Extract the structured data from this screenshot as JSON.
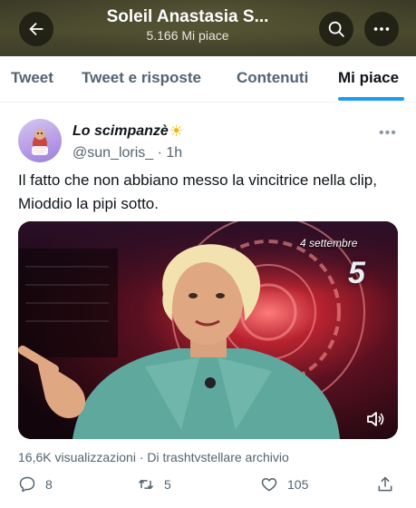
{
  "header": {
    "title": "Soleil Anastasia S...",
    "subtitle": "5.166 Mi piace",
    "back_icon": "arrow-left-icon",
    "search_icon": "search-icon",
    "more_icon": "more-horizontal-icon"
  },
  "tabs": [
    {
      "label": "Tweet",
      "active": false
    },
    {
      "label": "Tweet e risposte",
      "active": false
    },
    {
      "label": "Contenuti",
      "active": false
    },
    {
      "label": "Mi piace",
      "active": true
    }
  ],
  "tweet": {
    "author_name": "Lo scimpanzè",
    "author_emoji": "☀",
    "handle": "@sun_loris_",
    "time": "· 1h",
    "text": "Il fatto che non abbiano messo la vincitrice nella clip, Mioddio la pipi sotto.",
    "media": {
      "overlay_date": "4 settembre",
      "channel_logo": "5"
    },
    "meta": "16,6K visualizzazioni · Di trashtvstellare archivio",
    "actions": {
      "replies": "8",
      "retweets": "5",
      "likes": "105"
    }
  },
  "colors": {
    "accent": "#1d9bf0",
    "secondary_text": "#536471",
    "header_bg": "#3b3a26"
  }
}
